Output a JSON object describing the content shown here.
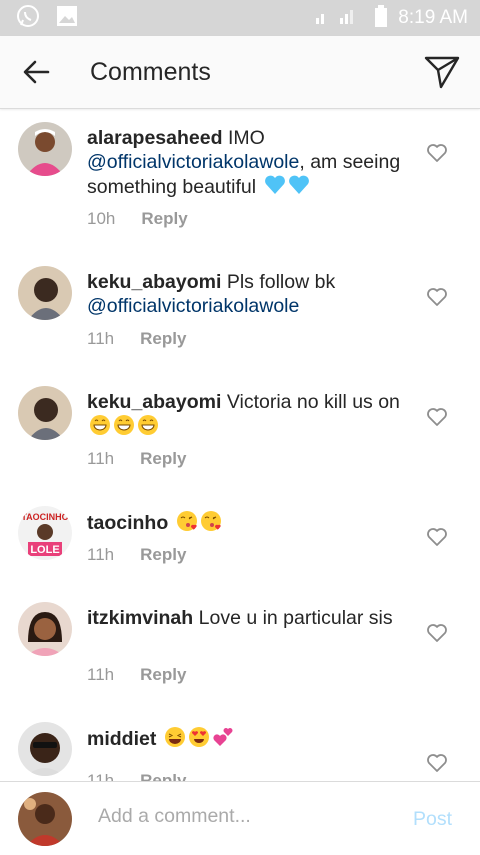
{
  "status_bar": {
    "time": "8:19 AM"
  },
  "header": {
    "title": "Comments"
  },
  "comments": [
    {
      "username": "alarapesaheed",
      "pre": "IMO ",
      "mention": "@officialvictoriakolawole",
      "post": ", am seeing something beautiful",
      "emojis": [
        "blue-heart",
        "blue-heart"
      ],
      "time": "10h",
      "reply": "Reply"
    },
    {
      "username": "keku_abayomi",
      "pre": "Pls follow bk ",
      "mention": "@officialvictoriakolawole",
      "post": "",
      "emojis": [],
      "time": "11h",
      "reply": "Reply"
    },
    {
      "username": "keku_abayomi",
      "pre": "Victoria no kill us on",
      "mention": "",
      "post": "",
      "emojis": [
        "grin",
        "grin",
        "grin"
      ],
      "time": "11h",
      "reply": "Reply"
    },
    {
      "username": "taocinho",
      "pre": "",
      "mention": "",
      "post": "",
      "emojis": [
        "kiss",
        "kiss"
      ],
      "time": "11h",
      "reply": "Reply"
    },
    {
      "username": "itzkimvinah",
      "pre": "Love u in particular sis",
      "mention": "",
      "post": "",
      "emojis": [],
      "time": "11h",
      "reply": "Reply"
    },
    {
      "username": "middiet",
      "pre": "",
      "mention": "",
      "post": "",
      "emojis": [
        "laugh",
        "heart-eyes",
        "two-hearts"
      ],
      "time": "11h",
      "reply": "Reply"
    }
  ],
  "composer": {
    "placeholder": "Add a comment...",
    "post_label": "Post"
  },
  "colors": {
    "mention": "#003569",
    "meta": "#999999",
    "post_disabled": "#b2dffc"
  }
}
